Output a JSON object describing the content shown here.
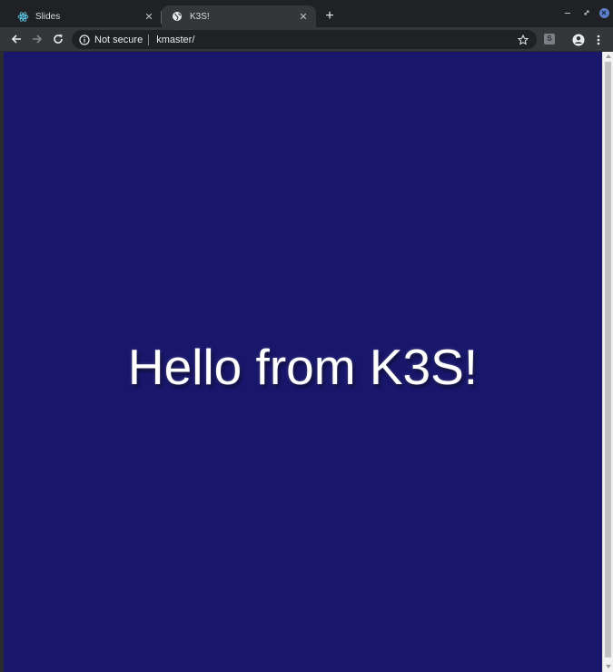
{
  "browser": {
    "tabs": [
      {
        "title": "Slides",
        "icon": "react-icon",
        "active": false
      },
      {
        "title": "K3S!",
        "icon": "globe-icon",
        "active": true
      }
    ],
    "close_glyph": "✕",
    "new_tab_glyph": "+",
    "address_bar": {
      "security_label": "Not secure",
      "url": "kmaster/"
    },
    "extension_label": "S",
    "colors": {
      "tab_strip": "#202124",
      "toolbar": "#35363a",
      "page_background": "#19176c"
    }
  },
  "page": {
    "headline": "Hello from K3S!"
  }
}
